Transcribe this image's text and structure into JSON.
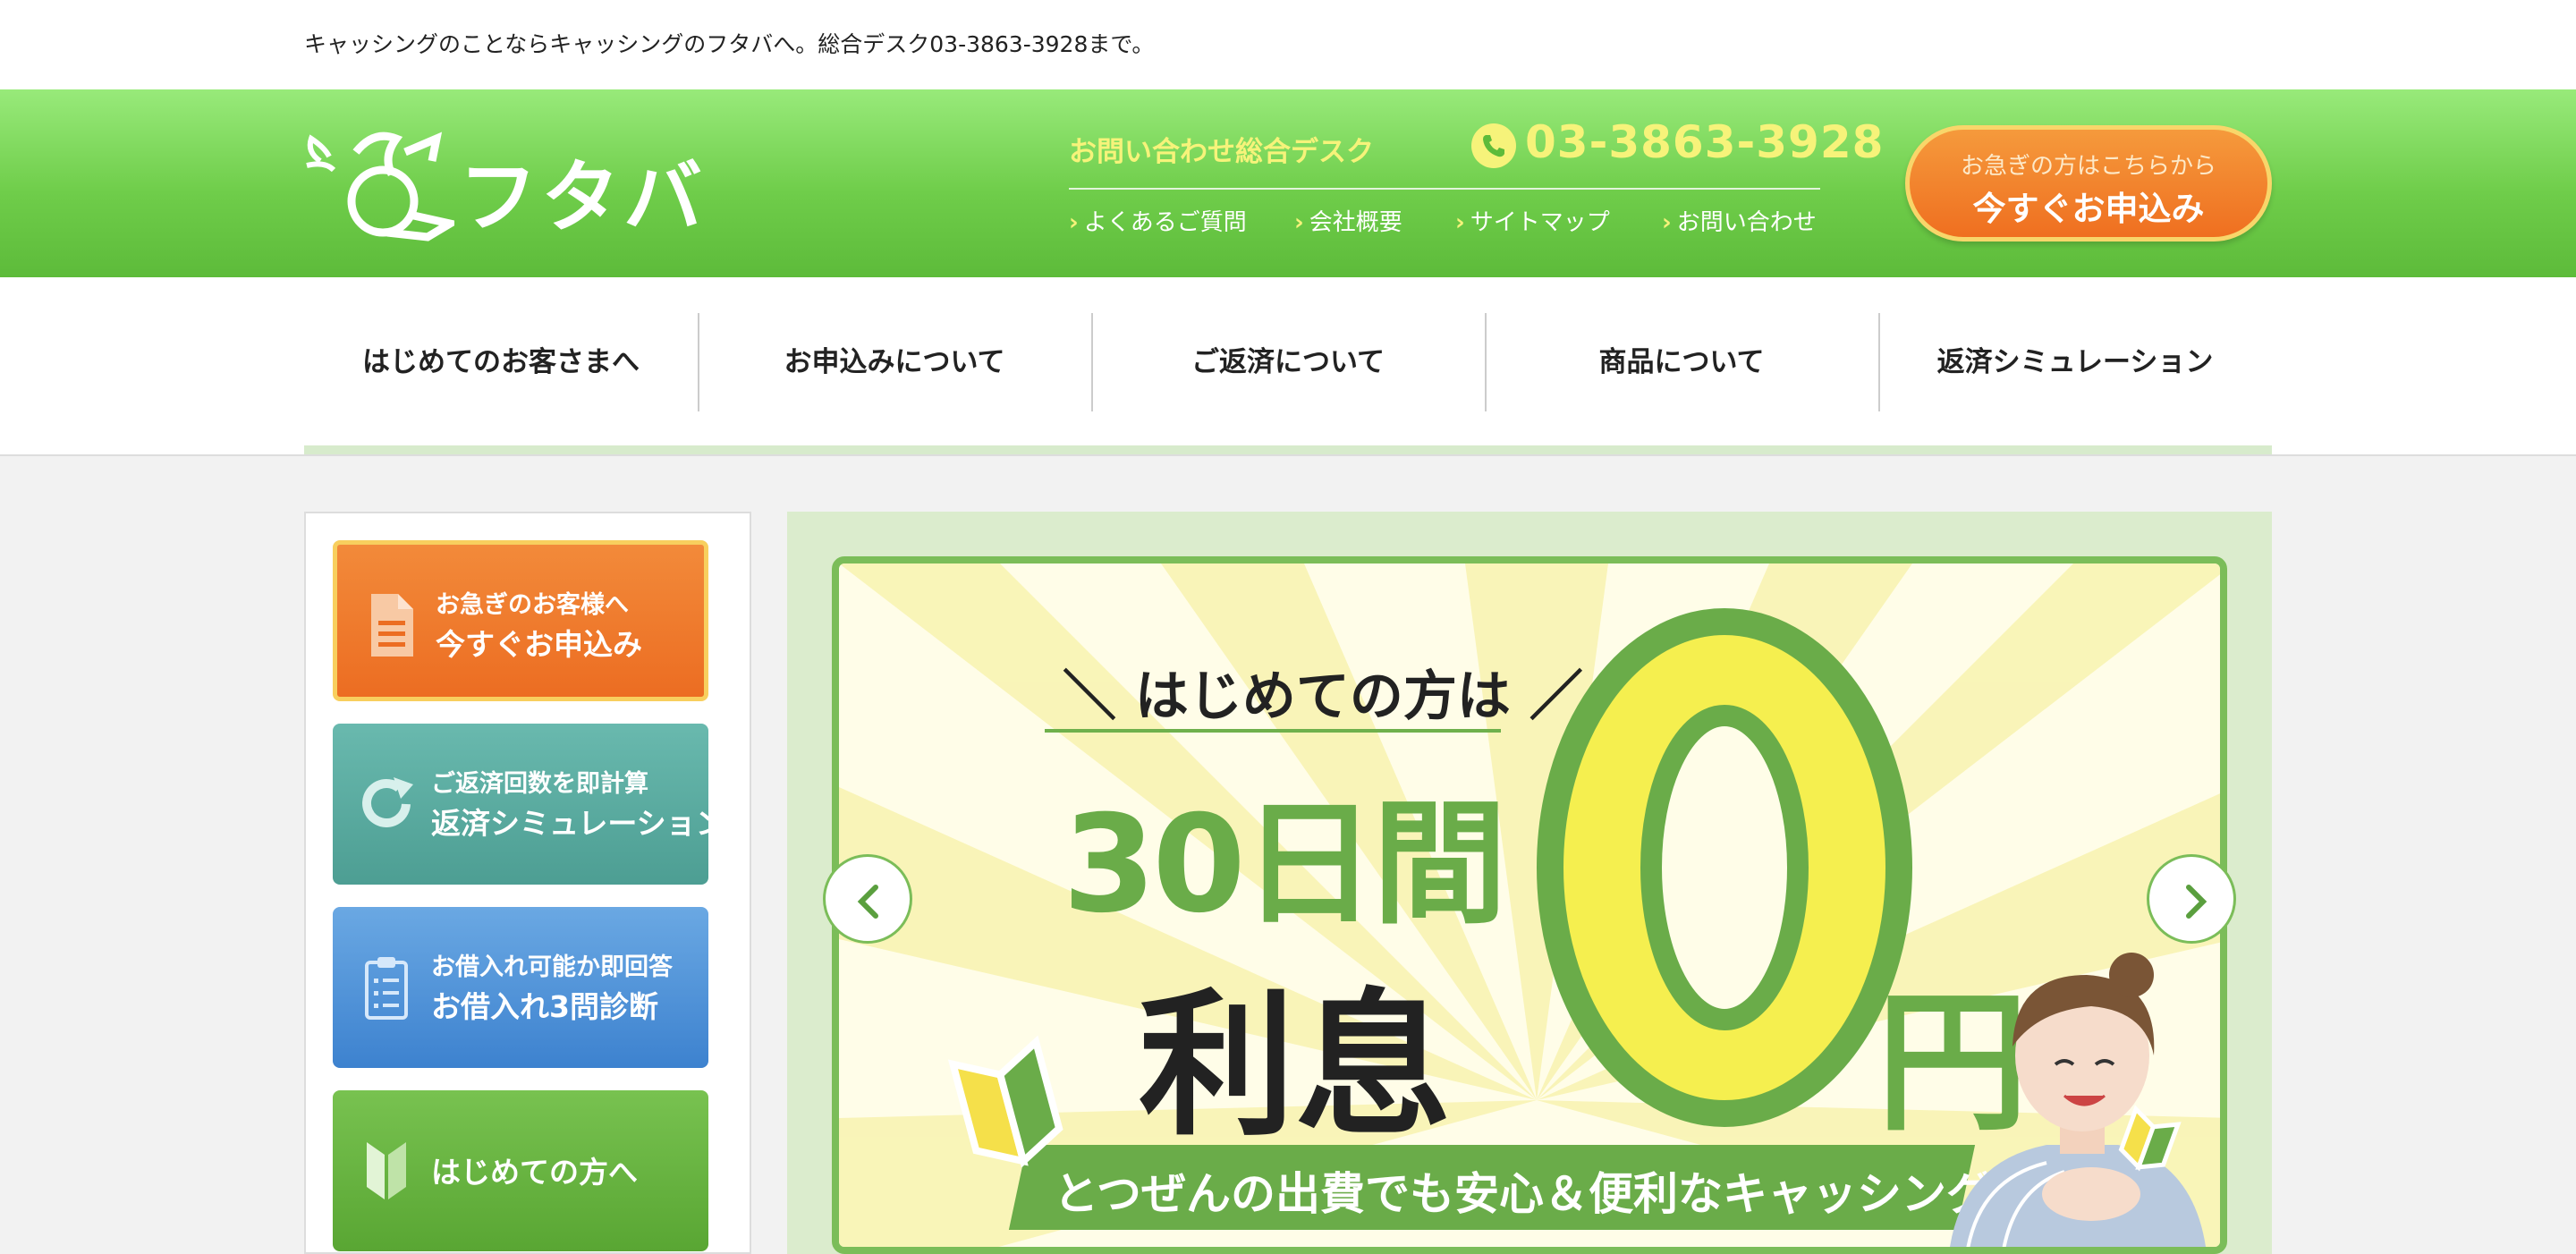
{
  "topbar": {
    "notice": "キャッシングのことならキャッシングのフタバへ。総合デスク03-3863-3928まで。"
  },
  "header": {
    "logo_text": "フタバ",
    "desk_label": "お問い合わせ総合デスク",
    "phone": "03-3863-3928",
    "links": [
      "よくあるご質問",
      "会社概要",
      "サイトマップ",
      "お問い合わせ"
    ],
    "apply_small": "お急ぎの方はこちらから",
    "apply_big": "今すぐお申込み"
  },
  "nav": {
    "items": [
      "はじめてのお客さまへ",
      "お申込みについて",
      "ご返済について",
      "商品について",
      "返済シミュレーション"
    ]
  },
  "sidebar": {
    "buttons": [
      {
        "small": "お急ぎのお客様へ",
        "large": "今すぐお申込み",
        "icon": "document-icon"
      },
      {
        "small": "ご返済回数を即計算",
        "large": "返済シミュレーション",
        "icon": "refresh-icon"
      },
      {
        "small": "お借入れ可能か即回答",
        "large": "お借入れ3問診断",
        "icon": "clipboard-icon"
      },
      {
        "small": "",
        "large": "はじめての方へ",
        "icon": "beginner-mark-icon"
      }
    ]
  },
  "hero": {
    "lead": "＼ はじめての方は ／",
    "days": "30日間",
    "risoku": "利息",
    "zero": "0",
    "yen": "円",
    "band": "とつぜんの出費でも安心＆便利なキャッシング"
  },
  "colors": {
    "green": "#6fcd4a",
    "yellow": "#f6f37a",
    "orange": "#ef6f20",
    "teal": "#4d9e93",
    "blue": "#3d82cf"
  }
}
